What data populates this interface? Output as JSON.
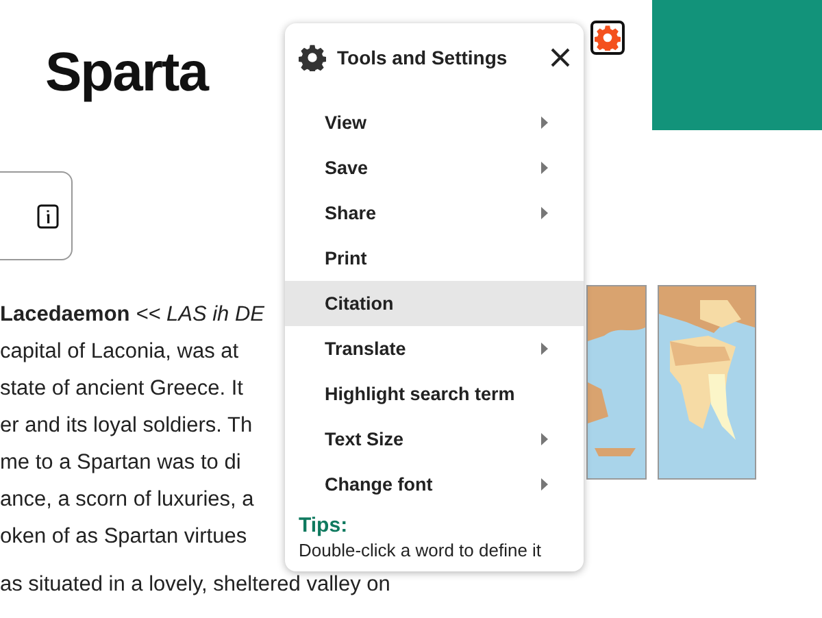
{
  "page": {
    "title": "Sparta"
  },
  "article": {
    "paragraphs": [
      [
        "**Lacedaemon** *<< LAS ih DE*",
        "capital of Laconia, was at",
        "state of ancient Greece. It",
        "er and its loyal soldiers. Th",
        "me to a Spartan was to di",
        "ance, a scorn of luxuries, a",
        "oken of as Spartan virtues"
      ],
      [
        "as situated in a lovely, sheltered valley on"
      ]
    ]
  },
  "menu": {
    "title": "Tools and Settings",
    "items": [
      {
        "label": "View",
        "has_submenu": true,
        "selected": false
      },
      {
        "label": "Save",
        "has_submenu": true,
        "selected": false
      },
      {
        "label": "Share",
        "has_submenu": true,
        "selected": false
      },
      {
        "label": "Print",
        "has_submenu": false,
        "selected": false
      },
      {
        "label": "Citation",
        "has_submenu": false,
        "selected": true
      },
      {
        "label": "Translate",
        "has_submenu": true,
        "selected": false
      },
      {
        "label": "Highlight search term",
        "has_submenu": false,
        "selected": false
      },
      {
        "label": "Text Size",
        "has_submenu": true,
        "selected": false
      },
      {
        "label": "Change font",
        "has_submenu": true,
        "selected": false
      }
    ],
    "tips": {
      "heading": "Tips:",
      "text": "Double-click a word to define it"
    }
  }
}
